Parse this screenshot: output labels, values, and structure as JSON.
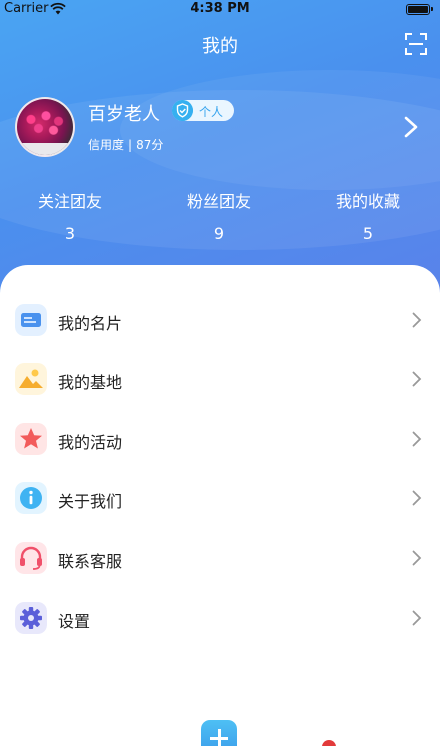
{
  "status_bar": {
    "carrier": "Carrier",
    "time": "4:38 PM"
  },
  "header": {
    "title": "我的"
  },
  "profile": {
    "username": "百岁老人",
    "badge": "个人",
    "credit_label": "信用度",
    "credit_value": "87分"
  },
  "stats": [
    {
      "label": "关注团友",
      "value": "3"
    },
    {
      "label": "粉丝团友",
      "value": "9"
    },
    {
      "label": "我的收藏",
      "value": "5"
    }
  ],
  "menu": [
    {
      "label": "我的名片",
      "icon": "business-card-icon"
    },
    {
      "label": "我的基地",
      "icon": "base-icon"
    },
    {
      "label": "我的活动",
      "icon": "star-icon"
    },
    {
      "label": "关于我们",
      "icon": "info-icon"
    },
    {
      "label": "联系客服",
      "icon": "headset-icon"
    },
    {
      "label": "设置",
      "icon": "settings-icon"
    }
  ],
  "colors": {
    "header_gradient_start": "#4aa5f3",
    "header_gradient_end": "#5a82ea",
    "accent": "#36a4ee"
  }
}
